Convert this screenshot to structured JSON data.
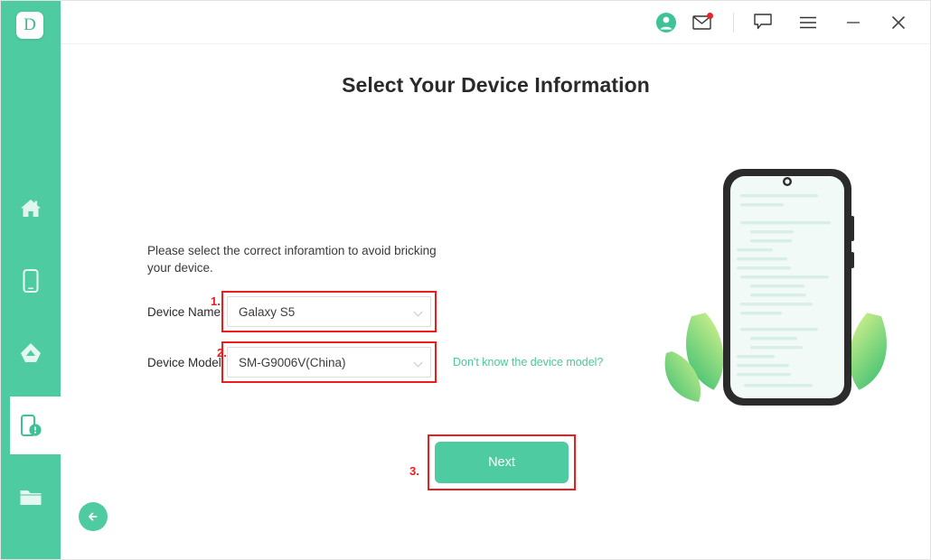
{
  "app": {
    "logo_letter": "D",
    "brand_color": "#4ECBA0",
    "accent_red": "#EF1C1C",
    "link_color": "#4BC79A"
  },
  "titlebar": {
    "icons": [
      {
        "name": "account-avatar-icon",
        "glyph": "account"
      },
      {
        "name": "mail-icon",
        "glyph": "envelope",
        "badge": true
      },
      {
        "name": "feedback-chat-icon",
        "glyph": "chat-bubble"
      },
      {
        "name": "menu-icon",
        "glyph": "hamburger"
      },
      {
        "name": "minimize-icon",
        "glyph": "minus"
      },
      {
        "name": "close-icon",
        "glyph": "cross"
      }
    ]
  },
  "sidebar": {
    "items": [
      {
        "name": "home",
        "icon": "home-icon",
        "active": false
      },
      {
        "name": "phone-transfer",
        "icon": "phone-icon",
        "active": false
      },
      {
        "name": "cloud-backup",
        "icon": "cloud-icon",
        "active": false
      },
      {
        "name": "system-repair",
        "icon": "phone-alert-icon",
        "active": true
      },
      {
        "name": "file-explorer",
        "icon": "folder-icon",
        "active": false
      }
    ]
  },
  "main": {
    "title": "Select Your Device Information",
    "instruction": "Please select the correct inforamtion to avoid bricking your device.",
    "fields": [
      {
        "key": "device_name",
        "label": "Device Name",
        "value": "Galaxy S5",
        "marker": "1.",
        "highlighted": true
      },
      {
        "key": "device_model",
        "label": "Device Model",
        "value": "SM-G9006V(China)",
        "marker": "2.",
        "highlighted": true,
        "help_link": "Don't know the device model?"
      }
    ],
    "next_button": {
      "label": "Next",
      "marker": "3.",
      "highlighted": true
    },
    "back_button": {
      "name": "back-button"
    }
  }
}
